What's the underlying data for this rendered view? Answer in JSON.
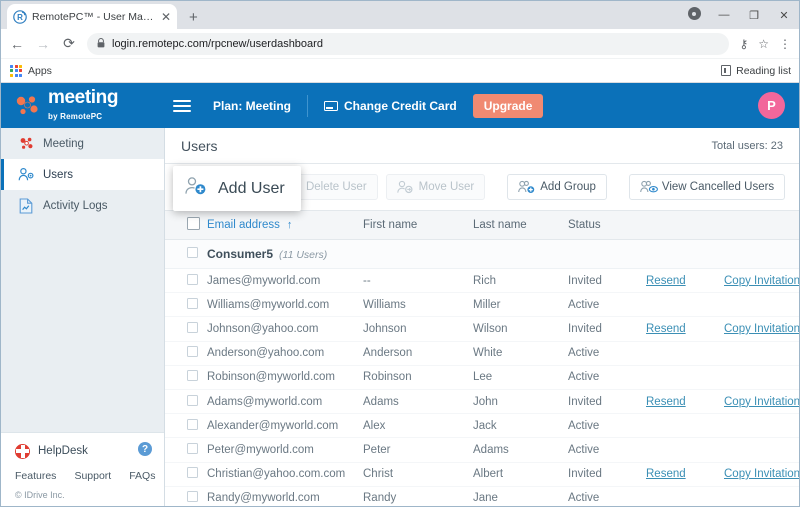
{
  "browser": {
    "tab_title": "RemotePC™ - User Management",
    "tab_close": "✕",
    "new_tab": "+",
    "back": "←",
    "forward": "→",
    "reload": "⟳",
    "lock_icon": "lock-icon",
    "url": "login.remotepc.com/rpcnew/userdashboard",
    "key_icon": "⚷",
    "star_icon": "☆",
    "menu_icon": "⋮",
    "bookmark_apps": "Apps",
    "reading_list": "Reading list",
    "minimize": "—",
    "maximize": "❐",
    "close": "✕"
  },
  "header": {
    "logo_main": "meeting",
    "logo_sub": "by RemotePC",
    "menu_icon": "hamburger-icon",
    "plan": "Plan: Meeting",
    "change_credit_card": "Change Credit Card",
    "upgrade": "Upgrade",
    "avatar_initial": "P",
    "bg_color": "#0b71b9",
    "upgrade_color": "#f08a72",
    "avatar_color": "#f2679b"
  },
  "sidebar": {
    "items": [
      {
        "label": "Meeting",
        "icon": "meeting-icon",
        "active": false
      },
      {
        "label": "Users",
        "icon": "users-icon",
        "active": true
      },
      {
        "label": "Activity Logs",
        "icon": "activity-logs-icon",
        "active": false
      }
    ],
    "helpdesk": "HelpDesk",
    "help_badge": "?",
    "footer_links": [
      "Features",
      "Support",
      "FAQs"
    ],
    "copyright": "© IDrive Inc."
  },
  "main": {
    "page_title": "Users",
    "total_users": "Total users: 23",
    "toolbar": {
      "add_user": "Add User",
      "delete_user": "Delete User",
      "move_user": "Move User",
      "add_group": "Add Group",
      "view_cancelled_users": "View Cancelled Users"
    },
    "table": {
      "headers": {
        "email": "Email address",
        "sort_arrow": "↑",
        "first_name": "First name",
        "last_name": "Last name",
        "status": "Status",
        "export_icon": "export-icon"
      },
      "group": {
        "name": "Consumer5",
        "count": "(11 Users)",
        "chevron": "⌃"
      },
      "rows": [
        {
          "email": "James@myworld.com",
          "first": "--",
          "last": "Rich",
          "status": "Invited",
          "resend": "Resend",
          "copy": "Copy Invitation"
        },
        {
          "email": "Williams@myworld.com",
          "first": "Williams",
          "last": "Miller",
          "status": "Active",
          "resend": "",
          "copy": ""
        },
        {
          "email": "Johnson@yahoo.com",
          "first": "Johnson",
          "last": "Wilson",
          "status": "Invited",
          "resend": "Resend",
          "copy": "Copy Invitation"
        },
        {
          "email": "Anderson@yahoo.com",
          "first": "Anderson",
          "last": "White",
          "status": "Active",
          "resend": "",
          "copy": ""
        },
        {
          "email": "Robinson@myworld.com",
          "first": "Robinson",
          "last": "Lee",
          "status": "Active",
          "resend": "",
          "copy": ""
        },
        {
          "email": "Adams@myworld.com",
          "first": "Adams",
          "last": "John",
          "status": "Invited",
          "resend": "Resend",
          "copy": "Copy Invitation"
        },
        {
          "email": "Alexander@myworld.com",
          "first": "Alex",
          "last": "Jack",
          "status": "Active",
          "resend": "",
          "copy": ""
        },
        {
          "email": "Peter@myworld.com",
          "first": "Peter",
          "last": "Adams",
          "status": "Active",
          "resend": "",
          "copy": ""
        },
        {
          "email": "Christian@yahoo.com.com",
          "first": "Christ",
          "last": "Albert",
          "status": "Invited",
          "resend": "Resend",
          "copy": "Copy Invitation"
        },
        {
          "email": "Randy@myworld.com",
          "first": "Randy",
          "last": "Jane",
          "status": "Active",
          "resend": "",
          "copy": ""
        }
      ]
    },
    "colors": {
      "invited": "#e5873b",
      "link": "#3b8fb5",
      "sorted_header": "#2f89cc"
    }
  }
}
